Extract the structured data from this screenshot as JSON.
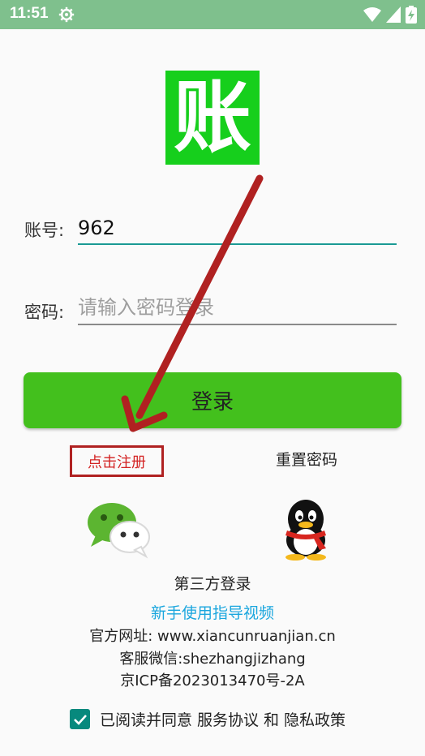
{
  "status_bar": {
    "time": "11:51",
    "icons": [
      "gear-icon",
      "wifi-icon",
      "signal-icon",
      "battery-charging-icon"
    ]
  },
  "logo": {
    "char": "账",
    "color": "#16cf1c"
  },
  "account": {
    "label": "账号:",
    "value": "962"
  },
  "password": {
    "label": "密码:",
    "placeholder": "请输入密码登录"
  },
  "login_button": {
    "label": "登录",
    "color": "#43c01d"
  },
  "register_link": {
    "label": "点击注册",
    "color": "#d32222"
  },
  "reset_link": {
    "label": "重置密码"
  },
  "third_party": {
    "icons": [
      "wechat-icon",
      "qq-icon"
    ],
    "label": "第三方登录"
  },
  "guide_link": {
    "label": "新手使用指导视频",
    "color": "#1aa6de"
  },
  "info": {
    "website": "官方网址: www.xiancunruanjian.cn",
    "wechat": "客服微信:shezhangjizhang",
    "icp": "京ICP备2023013470号-2A"
  },
  "agreement": {
    "checked": true,
    "prefix": "已阅读并同意",
    "service": "服务协议",
    "and": "和",
    "privacy": "隐私政策"
  },
  "annotation_arrow": {
    "color": "#b02121"
  }
}
